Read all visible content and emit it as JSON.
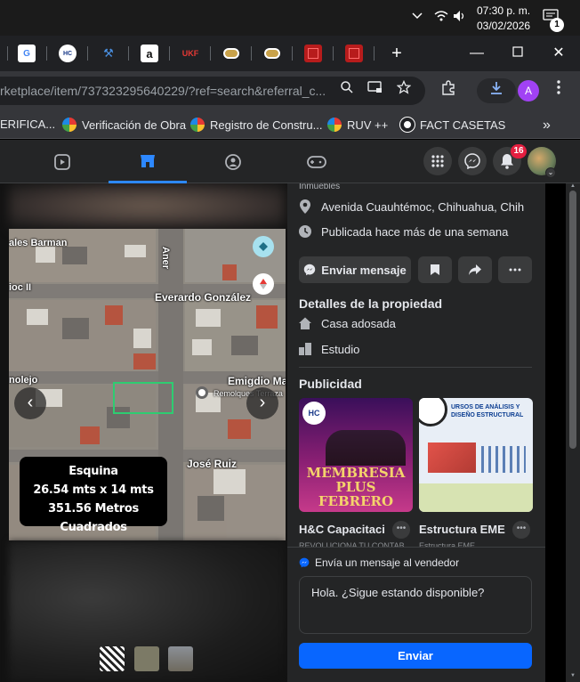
{
  "taskbar": {
    "time": "07:30 p. m.",
    "date": "03/02/2026",
    "notification_count": "1"
  },
  "tabs": [
    {
      "icon": "google-icon",
      "label": "G"
    },
    {
      "icon": "hc-icon",
      "label": "HC"
    },
    {
      "icon": "tools-icon",
      "label": "🛠"
    },
    {
      "icon": "amazon-icon",
      "label": "a"
    },
    {
      "icon": "ukf-icon",
      "label": "UKF"
    },
    {
      "icon": "chip-icon",
      "label": ""
    },
    {
      "icon": "chip-icon",
      "label": ""
    },
    {
      "icon": "red-square-icon",
      "label": ""
    },
    {
      "icon": "red-square-icon",
      "label": ""
    }
  ],
  "address": {
    "url": "rketplace/item/737323295640229/?ref=search&referral_c..."
  },
  "bookmarks": [
    {
      "label": "ERIFICA..."
    },
    {
      "label": "Verificación de Obra"
    },
    {
      "label": "Registro de Constru..."
    },
    {
      "label": "RUV ++"
    },
    {
      "label": "FACT CASETAS"
    }
  ],
  "facebook": {
    "notifications_badge": "16",
    "profile_initial": "A"
  },
  "photo": {
    "caption_line1": "Esquina",
    "caption_line2": "26.54 mts x 14 mts",
    "caption_line3": "351.56 Metros Cuadrados",
    "street_labels": {
      "s1": "ales Barman",
      "s2": "Everardo González",
      "s3": "nolejo",
      "s4": "Emigdio Mar",
      "s5": "José Ruiz",
      "s6": "Aner",
      "s7": "Remolques Terraza",
      "s8": "ioc II"
    }
  },
  "listing": {
    "category_hint": "Inmuebles",
    "location": "Avenida Cuauhtémoc, Chihuahua, Chih",
    "posted": "Publicada hace más de una semana",
    "message_button": "Enviar mensaje",
    "details_title": "Detalles de la propiedad",
    "property_type": "Casa adosada",
    "rooms": "Estudio",
    "ads_title": "Publicidad"
  },
  "ads": [
    {
      "name": "H&C Capacitaci...",
      "subtitle": "REVOLUCIONA TU CONTAB...",
      "headline1": "MEMBRESIA",
      "headline2": "PLUS FEBRERO",
      "logo": "HC"
    },
    {
      "name": "Estructura EME",
      "subtitle": "Estructura EME",
      "headline1": "URSOS DE ANÁLISIS Y",
      "headline2": "DISEÑO ESTRUCTURAL"
    }
  ],
  "message": {
    "prompt": "Envía un mensaje al vendedor",
    "text": "Hola. ¿Sigue estando disponible?",
    "send": "Enviar"
  },
  "colors": {
    "fb_blue": "#0866ff",
    "panel_bg": "#242526",
    "badge_red": "#e41e3f"
  }
}
